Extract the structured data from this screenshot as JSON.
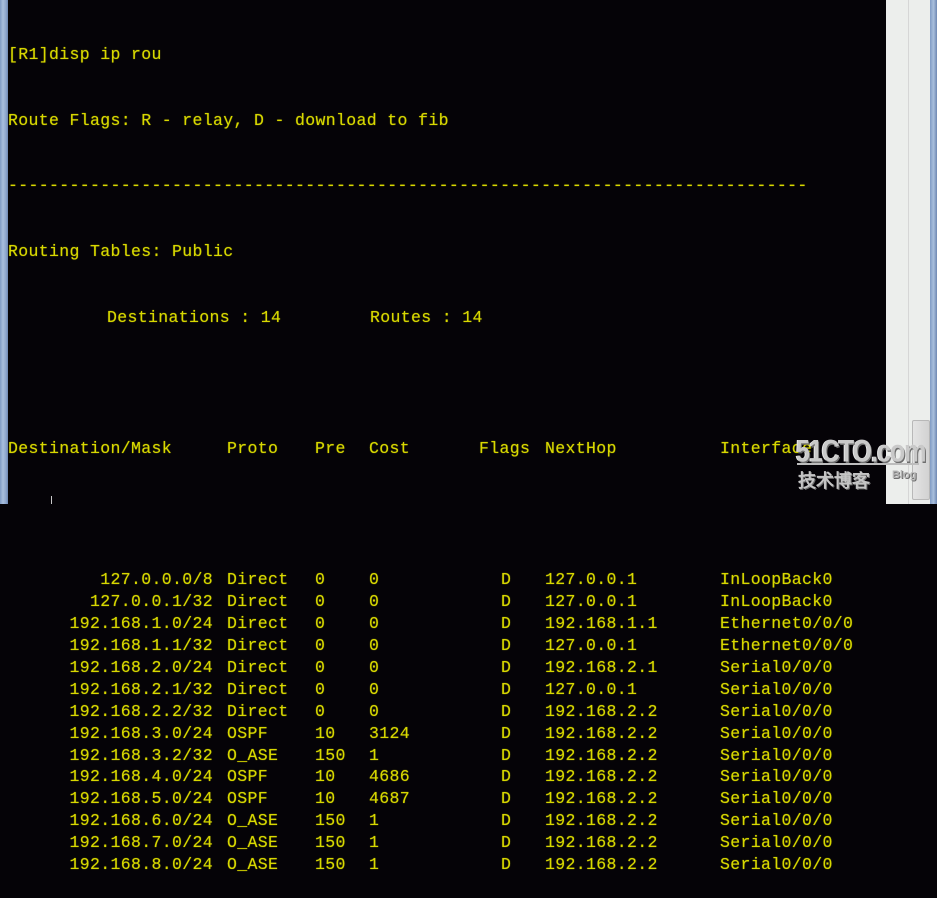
{
  "terminal": {
    "command_line": "[R1]disp ip rou",
    "flags_legend": "Route Flags: R - relay, D - download to fib",
    "separator": "------------------------------------------------------------------------------",
    "table_title": "Routing Tables: Public",
    "summary": {
      "destinations_label": "Destinations : 14",
      "routes_label": "Routes : 14"
    },
    "columns": {
      "destination": "Destination/Mask",
      "proto": "Proto",
      "pre": "Pre",
      "cost": "Cost",
      "flags": "Flags",
      "nexthop": "NextHop",
      "interface": "Interface"
    },
    "routes": [
      {
        "destination": "127.0.0.0/8",
        "proto": "Direct",
        "pre": "0",
        "cost": "0",
        "flags": "D",
        "nexthop": "127.0.0.1",
        "interface": "InLoopBack0"
      },
      {
        "destination": "127.0.0.1/32",
        "proto": "Direct",
        "pre": "0",
        "cost": "0",
        "flags": "D",
        "nexthop": "127.0.0.1",
        "interface": "InLoopBack0"
      },
      {
        "destination": "192.168.1.0/24",
        "proto": "Direct",
        "pre": "0",
        "cost": "0",
        "flags": "D",
        "nexthop": "192.168.1.1",
        "interface": "Ethernet0/0/0"
      },
      {
        "destination": "192.168.1.1/32",
        "proto": "Direct",
        "pre": "0",
        "cost": "0",
        "flags": "D",
        "nexthop": "127.0.0.1",
        "interface": "Ethernet0/0/0"
      },
      {
        "destination": "192.168.2.0/24",
        "proto": "Direct",
        "pre": "0",
        "cost": "0",
        "flags": "D",
        "nexthop": "192.168.2.1",
        "interface": "Serial0/0/0"
      },
      {
        "destination": "192.168.2.1/32",
        "proto": "Direct",
        "pre": "0",
        "cost": "0",
        "flags": "D",
        "nexthop": "127.0.0.1",
        "interface": "Serial0/0/0"
      },
      {
        "destination": "192.168.2.2/32",
        "proto": "Direct",
        "pre": "0",
        "cost": "0",
        "flags": "D",
        "nexthop": "192.168.2.2",
        "interface": "Serial0/0/0"
      },
      {
        "destination": "192.168.3.0/24",
        "proto": "OSPF",
        "pre": "10",
        "cost": "3124",
        "flags": "D",
        "nexthop": "192.168.2.2",
        "interface": "Serial0/0/0"
      },
      {
        "destination": "192.168.3.2/32",
        "proto": "O_ASE",
        "pre": "150",
        "cost": "1",
        "flags": "D",
        "nexthop": "192.168.2.2",
        "interface": "Serial0/0/0"
      },
      {
        "destination": "192.168.4.0/24",
        "proto": "OSPF",
        "pre": "10",
        "cost": "4686",
        "flags": "D",
        "nexthop": "192.168.2.2",
        "interface": "Serial0/0/0"
      },
      {
        "destination": "192.168.5.0/24",
        "proto": "OSPF",
        "pre": "10",
        "cost": "4687",
        "flags": "D",
        "nexthop": "192.168.2.2",
        "interface": "Serial0/0/0"
      },
      {
        "destination": "192.168.6.0/24",
        "proto": "O_ASE",
        "pre": "150",
        "cost": "1",
        "flags": "D",
        "nexthop": "192.168.2.2",
        "interface": "Serial0/0/0"
      },
      {
        "destination": "192.168.7.0/24",
        "proto": "O_ASE",
        "pre": "150",
        "cost": "1",
        "flags": "D",
        "nexthop": "192.168.2.2",
        "interface": "Serial0/0/0"
      },
      {
        "destination": "192.168.8.0/24",
        "proto": "O_ASE",
        "pre": "150",
        "cost": "1",
        "flags": "D",
        "nexthop": "192.168.2.2",
        "interface": "Serial0/0/0"
      }
    ]
  },
  "watermark": {
    "logo": "51CTO.com",
    "subtitle_cn": "技术博客",
    "subtitle_en": "Blog"
  },
  "colors": {
    "terminal_text": "#d8d800",
    "terminal_bg": "#050307",
    "window_border": "#8da6cc",
    "scrollbar_bg": "#eceeec"
  }
}
